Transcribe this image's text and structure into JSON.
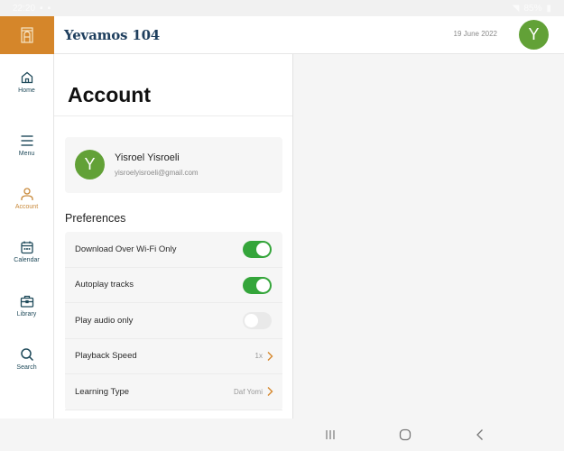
{
  "status_bar": {
    "time": "22:20",
    "battery": "85%"
  },
  "header": {
    "title": "Yevamos 104",
    "date": "19 June 2022",
    "avatar_initial": "Y"
  },
  "sidebar": {
    "items": [
      {
        "label": "Home",
        "icon": "home-icon",
        "active": false
      },
      {
        "label": "Menu",
        "icon": "menu-icon",
        "active": false
      },
      {
        "label": "Account",
        "icon": "account-icon",
        "active": true
      },
      {
        "label": "Calendar",
        "icon": "calendar-icon",
        "active": false
      },
      {
        "label": "Library",
        "icon": "library-icon",
        "active": false
      },
      {
        "label": "Search",
        "icon": "search-icon",
        "active": false
      }
    ]
  },
  "account": {
    "title": "Account",
    "profile": {
      "initial": "Y",
      "name": "Yisroel Yisroeli",
      "email": "yisroelyisroeli@gmail.com"
    },
    "preferences_title": "Preferences",
    "preferences": [
      {
        "label": "Download Over Wi-Fi Only",
        "type": "toggle",
        "on": true
      },
      {
        "label": "Autoplay tracks",
        "type": "toggle",
        "on": true
      },
      {
        "label": "Play audio only",
        "type": "toggle",
        "on": false
      },
      {
        "label": "Playback Speed",
        "type": "link",
        "value": "1x"
      },
      {
        "label": "Learning Type",
        "type": "link",
        "value": "Daf Yomi"
      }
    ]
  },
  "colors": {
    "brand_orange": "#d5862a",
    "title_navy": "#1f3f5e",
    "avatar_green": "#62a137",
    "toggle_on": "#34a53a",
    "active_nav": "#c8893a",
    "nav_text": "#1f4a5a"
  }
}
